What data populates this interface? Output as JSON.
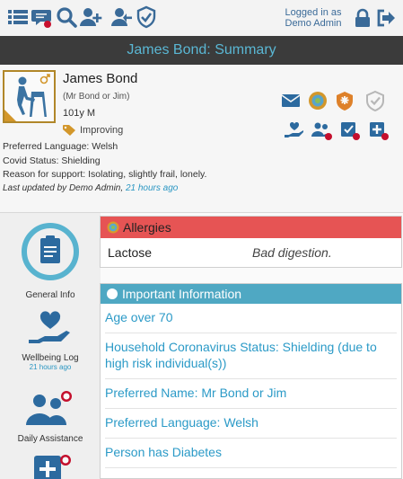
{
  "header": {
    "logged_in_line1": "Logged in as",
    "logged_in_line2": "Demo Admin",
    "icons": [
      "list-icon",
      "chat-alert-icon",
      "search-icon",
      "add-user-icon",
      "user-arrow-icon",
      "shield-check-icon",
      "lock-icon",
      "logout-icon"
    ]
  },
  "title": "James Bond: Summary",
  "person": {
    "name": "James Bond",
    "alias": "(Mr Bond or Jim)",
    "age_gender": "101y  M",
    "status": "Improving",
    "preferred_language": "Preferred Language: Welsh",
    "covid_status": "Covid Status: Shielding",
    "reason_for_support": "Reason for support: Isolating, slightly frail, lonely.",
    "updated_by": "Last updated by Demo Admin,",
    "updated_time": "21 hours ago"
  },
  "sidebar": {
    "items": [
      {
        "label": "General Info",
        "sub": ""
      },
      {
        "label": "Wellbeing Log",
        "sub": "21 hours ago"
      },
      {
        "label": "Daily Assistance",
        "sub": ""
      }
    ]
  },
  "allergies": {
    "title": "Allergies",
    "rows": [
      {
        "name": "Lactose",
        "note": "Bad digestion."
      }
    ]
  },
  "important": {
    "title": "Important Information",
    "items": [
      "Age over 70",
      "Household Coronavirus Status: Shielding (due to high risk individual(s))",
      "Preferred Name: Mr Bond or Jim",
      "Preferred Language: Welsh",
      "Person has Diabetes"
    ]
  },
  "colors": {
    "accent_blue": "#2b9ac7",
    "header_icon_blue": "#3a6a98",
    "allergy_red": "#e65454",
    "info_teal": "#4fa8c3",
    "title_bar": "#3b3b3b"
  }
}
